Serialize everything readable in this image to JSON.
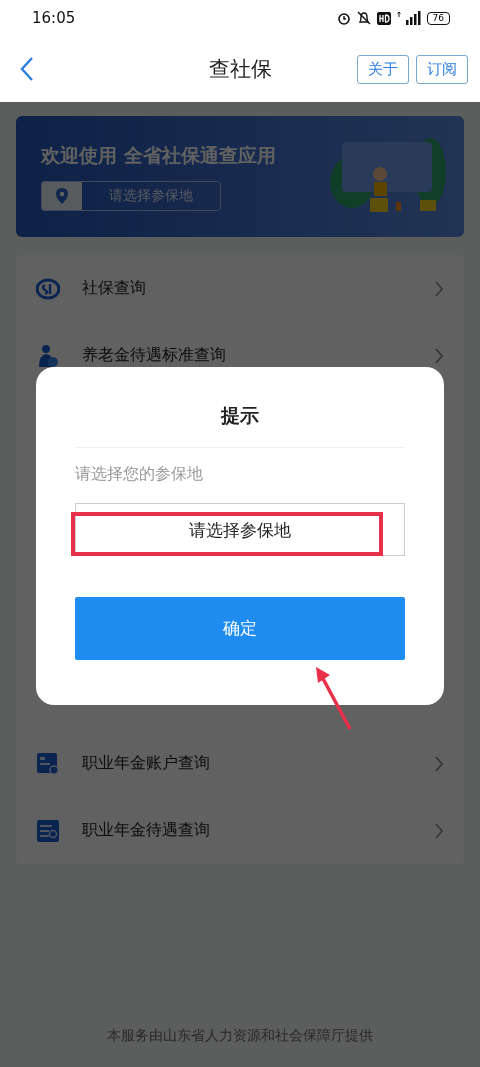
{
  "status_bar": {
    "time": "16:05",
    "battery": "76"
  },
  "nav": {
    "title": "查社保",
    "buttons": [
      "关于",
      "订阅"
    ]
  },
  "banner": {
    "title": "欢迎使用 全省社保通查应用",
    "location_placeholder": "请选择参保地"
  },
  "menu": [
    {
      "label": "社保查询",
      "kind": "logo"
    },
    {
      "label": "养老金待遇标准查询",
      "kind": "person"
    },
    {
      "label": "职业年金账户查询",
      "kind": "card"
    },
    {
      "label": "职业年金待遇查询",
      "kind": "list"
    }
  ],
  "dialog": {
    "title": "提示",
    "prompt": "请选择您的参保地",
    "field": {
      "placeholder": "请选择参保地"
    },
    "confirm": "确定"
  },
  "footer": "本服务由山东省人力资源和社会保障厅提供"
}
